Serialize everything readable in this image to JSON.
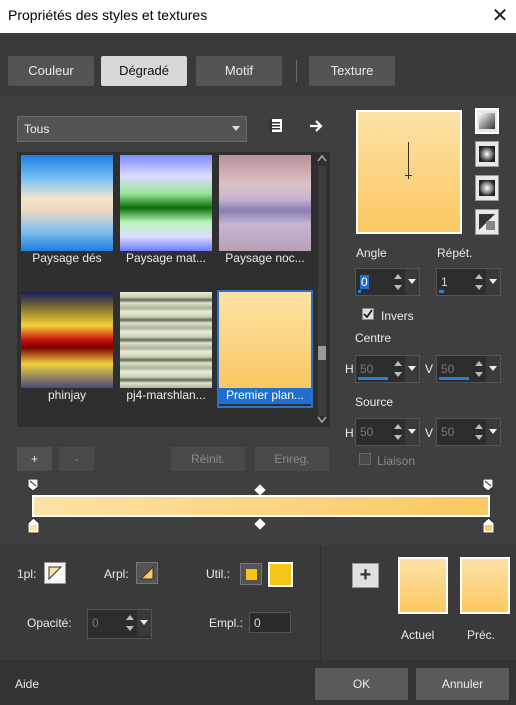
{
  "window": {
    "title": "Propriétés des styles et textures",
    "close_glyph": "✕"
  },
  "tabs": [
    {
      "label": "Couleur"
    },
    {
      "label": "Dégradé"
    },
    {
      "label": "Motif"
    },
    {
      "label": "Texture"
    }
  ],
  "category": {
    "value": "Tous"
  },
  "gradients": [
    {
      "label": "Paysage dés"
    },
    {
      "label": "Paysage mat..."
    },
    {
      "label": "Paysage noc..."
    },
    {
      "label": "phinjay"
    },
    {
      "label": "pj4-marshlan..."
    },
    {
      "label": "Premier plan..."
    }
  ],
  "list_buttons": {
    "add": "+",
    "remove": "-",
    "reset": "Réinit.",
    "save": "Enreg."
  },
  "angle": {
    "label": "Angle",
    "value": "0"
  },
  "repeat": {
    "label": "Répét.",
    "value": "1"
  },
  "invert": {
    "label": "Invers",
    "checked": true
  },
  "center": {
    "label": "Centre",
    "h_label": "H",
    "h_value": "50",
    "v_label": "V",
    "v_value": "50"
  },
  "source": {
    "label": "Source",
    "h_label": "H",
    "h_value": "50",
    "v_label": "V",
    "v_value": "50"
  },
  "link": {
    "label": "Liaison",
    "checked": false
  },
  "stops": {
    "fg_label": "1pl:",
    "bg_label": "Arpl:",
    "use_label": "Util.:",
    "opacity_label": "Opacité:",
    "opacity_value": "0",
    "location_label": "Empl.:",
    "location_value": "0"
  },
  "preview": {
    "current_label": "Actuel",
    "previous_label": "Préc.",
    "add_glyph": "+"
  },
  "footer": {
    "help": "Aide",
    "ok": "OK",
    "cancel": "Annuler"
  },
  "colors": {
    "gradient_start": "#fde2a6",
    "gradient_end": "#fbc862",
    "selection": "#1e6fce",
    "swatch_yellow": "#f5c518"
  }
}
